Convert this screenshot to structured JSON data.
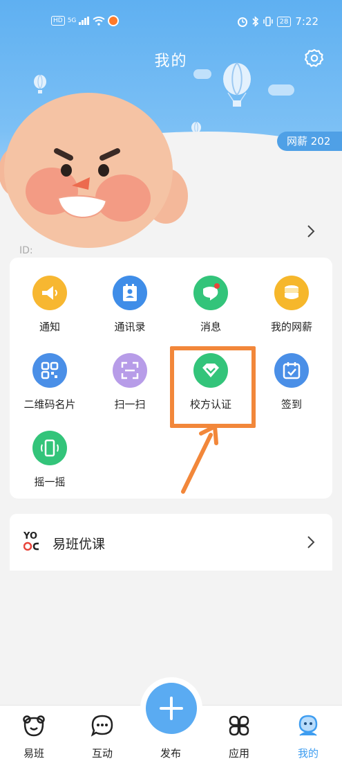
{
  "status_bar": {
    "left_chips": [
      "HD",
      "5G"
    ],
    "battery": "28",
    "time": "7:22"
  },
  "header": {
    "title": "我的",
    "wanxin_badge": "网薪 202"
  },
  "profile": {
    "id_label": "ID:"
  },
  "grid_items": [
    {
      "label": "通知",
      "icon": "megaphone-icon",
      "color": "#f7b731"
    },
    {
      "label": "通讯录",
      "icon": "contacts-icon",
      "color": "#3f8de8"
    },
    {
      "label": "消息",
      "icon": "message-icon",
      "color": "#33c47a"
    },
    {
      "label": "我的网薪",
      "icon": "coins-icon",
      "color": "#f6b72b"
    },
    {
      "label": "二维码名片",
      "icon": "qrcode-icon",
      "color": "#4a8fe7"
    },
    {
      "label": "扫一扫",
      "icon": "scan-icon",
      "color": "#b79ce8"
    },
    {
      "label": "校方认证",
      "icon": "diamond-icon",
      "color": "#33c47a"
    },
    {
      "label": "签到",
      "icon": "calendar-check-icon",
      "color": "#4a8fe7"
    },
    {
      "label": "摇一摇",
      "icon": "shake-phone-icon",
      "color": "#33c47a"
    }
  ],
  "course_row": {
    "label": "易班优课",
    "logo_text": "YO"
  },
  "tabs": [
    {
      "label": "易班",
      "icon": "bear-icon"
    },
    {
      "label": "互动",
      "icon": "chat-bubble-icon"
    },
    {
      "label": "发布",
      "icon": "plus-icon"
    },
    {
      "label": "应用",
      "icon": "apps-grid-icon"
    },
    {
      "label": "我的",
      "icon": "person-icon"
    }
  ],
  "colors": {
    "header_blue": "#5fb0f1",
    "accent": "#3e9df0",
    "highlight_orange": "#f2873a"
  }
}
